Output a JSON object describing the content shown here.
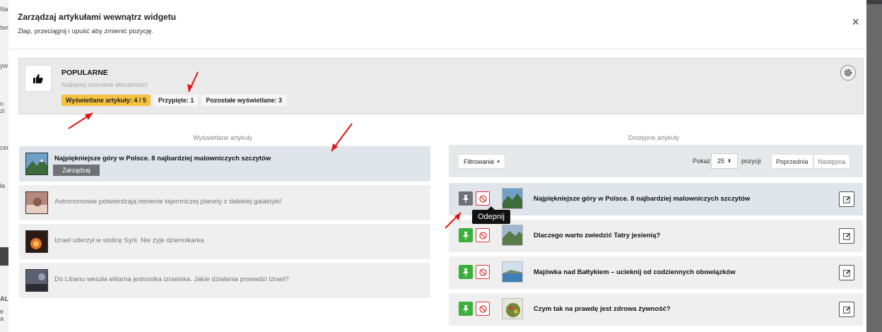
{
  "modal": {
    "title": "Zarządzaj artykułami wewnątrz widgetu",
    "subtitle": "Złap, przeciągnij i upuść aby zmienić pozycję.",
    "close_label": "×"
  },
  "widget": {
    "icon": "thumbs-up-icon",
    "title": "POPULARNE",
    "description": "Najlepiej oceniane aktualności",
    "badges": {
      "displayed": "Wyświetlane artykuły: 4 / 5",
      "pinned": "Przypięte: 1",
      "remaining": "Pozostałe wyświetlane: 3"
    }
  },
  "left_column": {
    "title": "Wyświetlane artykuły",
    "manage_label": "Zarządzaj",
    "items": [
      {
        "title": "Najpiękniejsze góry w Polsce. 8 najbardziej malowniczych szczytów",
        "active": true
      },
      {
        "title": "Astronomowie potwierdzają istnienie tajemniczej planety z dalekiej galaktyki!",
        "active": false
      },
      {
        "title": "Izrael uderzył w stolicę Syrii. Nie żyje dziennikarka",
        "active": false
      },
      {
        "title": "Do Libanu weszła elitarna jednostka izraelska. Jakie działania prowadzi Izrael?",
        "active": false
      }
    ]
  },
  "right_column": {
    "title": "Dostępne artykuły",
    "filter_label": "Filtrowanie",
    "show_label": "Pokaż",
    "page_size": "25",
    "positions_label": "pozycji",
    "prev_label": "Poprzednia",
    "next_label": "Następna",
    "tooltip": "Odepnij",
    "items": [
      {
        "title": "Najpiękniejsze góry w Polsce. 8 najbardziej malowniczych szczytów",
        "pinned": true
      },
      {
        "title": "Dlaczego warto zwiedzić Tatry jesienią?",
        "pinned": false
      },
      {
        "title": "Majówka nad Bałtykiem – ucieknij od codziennych obowiązków",
        "pinned": false
      },
      {
        "title": "Czym tak na prawdę jest zdrowa żywność?",
        "pinned": false
      }
    ]
  },
  "background": {
    "left_fragments": [
      "Nazwa",
      "twor",
      "yw",
      "n zi",
      "ced",
      "ła",
      "ALI",
      "e a"
    ]
  },
  "colors": {
    "accent_yellow": "#f5c242",
    "pin_green": "#3cae3c",
    "block_red": "#dd3333",
    "annotation_red": "#e01515"
  }
}
